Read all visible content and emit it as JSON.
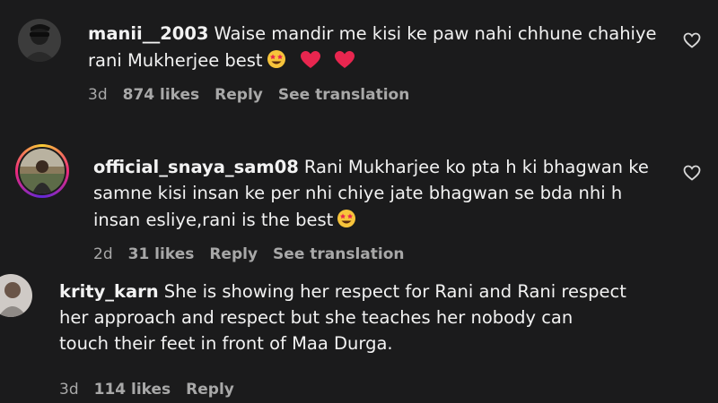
{
  "comments": [
    {
      "username": "manii__2003",
      "lines": [
        "Waise mandir me kisi ke paw nahi chhune chahiye",
        "rani Mukherjee best"
      ],
      "emojis": [
        "star-struck-emoji",
        "red-heart-emoji",
        "red-heart-emoji"
      ],
      "time": "3d",
      "likes": "874 likes",
      "reply": "Reply",
      "translation": "See translation"
    },
    {
      "username": "official_snaya_sam08",
      "lines": [
        "Rani Mukharjee ko pta h ki bhagwan ke",
        "samne kisi insan ke per nhi chiye jate bhagwan se bda nhi h",
        "insan esliye,rani is the best"
      ],
      "emojis": [
        "star-struck-emoji"
      ],
      "time": "2d",
      "likes": "31 likes",
      "reply": "Reply",
      "translation": "See translation"
    },
    {
      "username": "krity_karn",
      "lines": [
        "She is showing her respect for Rani and Rani respect",
        "her approach and respect but she teaches her nobody can",
        "touch their feet in front of Maa Durga."
      ],
      "time": "3d",
      "likes": "114 likes",
      "reply": "Reply"
    }
  ],
  "colors": {
    "background": "#1b1b1c",
    "text": "#f2f2f2",
    "meta": "#a8a8a8",
    "heart_emoji": "#e8264f",
    "story_ring": "#ee2a7b"
  }
}
